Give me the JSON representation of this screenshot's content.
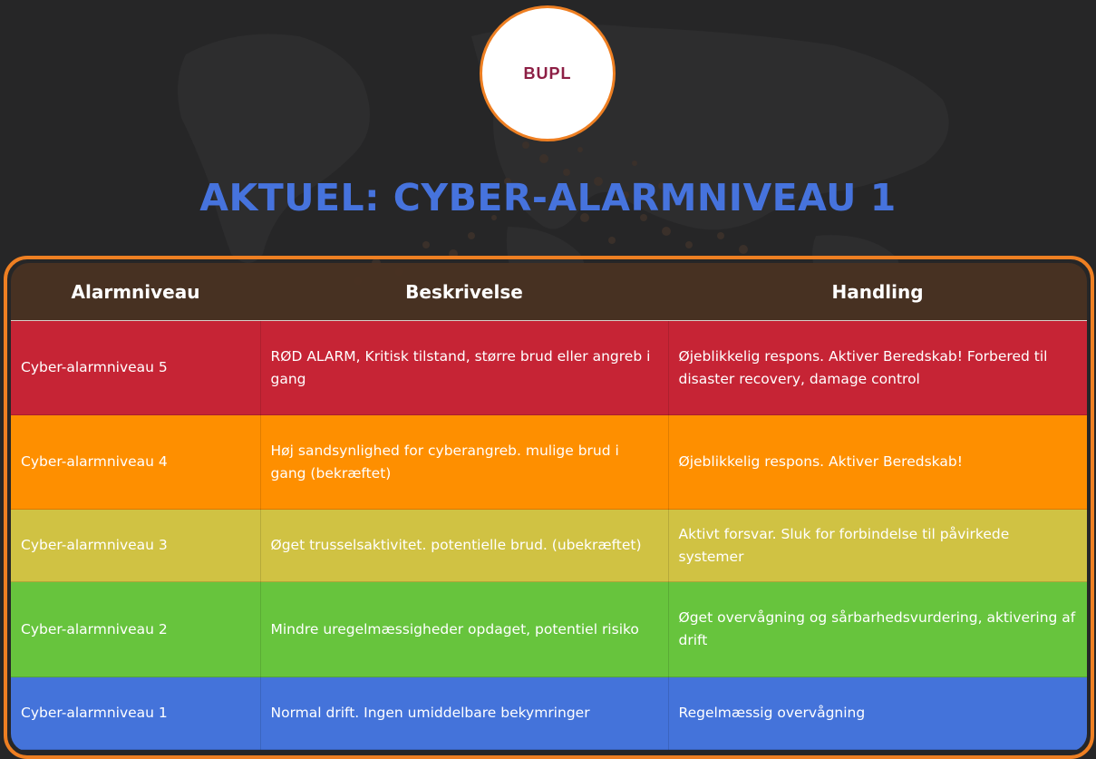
{
  "logo": {
    "text": "BUPL",
    "color": "#8d1f45"
  },
  "title": "AKTUEL: CYBER-ALARMNIVEAU 1",
  "colors": {
    "background": "#262627",
    "accent_border": "#ee7f22",
    "title": "#4673dd",
    "header_bg": "#483222"
  },
  "table": {
    "headers": [
      "Alarmniveau",
      "Beskrivelse",
      "Handling"
    ],
    "rows": [
      {
        "level": "Cyber-alarmniveau 5",
        "description": "RØD ALARM, Kritisk tilstand, større brud eller angreb i gang",
        "action": "Øjeblikkelig respons. Aktiver Beredskab! Forbered til disaster recovery, damage control",
        "color": "#c62435"
      },
      {
        "level": "Cyber-alarmniveau 4",
        "description": "Høj sandsynlighed for cyberangreb. mulige brud i gang (bekræftet)",
        "action": "Øjeblikkelig respons. Aktiver Beredskab!",
        "color": "#fe8f00"
      },
      {
        "level": "Cyber-alarmniveau 3",
        "description": "Øget trusselsaktivitet. potentielle brud. (ubekræftet)",
        "action": "Aktivt forsvar. Sluk for forbindelse til påvirkede systemer",
        "color": "#d0c243"
      },
      {
        "level": "Cyber-alarmniveau 2",
        "description": "Mindre uregelmæssigheder opdaget, potentiel risiko",
        "action": "Øget overvågning og sårbarhedsvurdering, aktivering af drift",
        "color": "#67c43d"
      },
      {
        "level": "Cyber-alarmniveau 1",
        "description": "Normal drift. Ingen umiddelbare bekymringer",
        "action": "Regelmæssig overvågning",
        "color": "#4473da"
      }
    ]
  }
}
